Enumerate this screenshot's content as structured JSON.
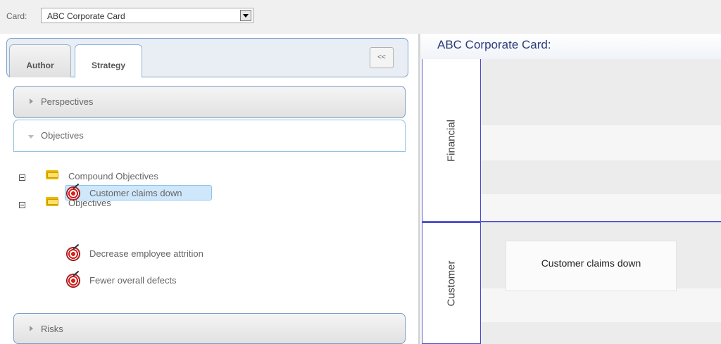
{
  "topbar": {
    "card_label": "Card:",
    "card_value": "ABC Corporate Card"
  },
  "left_panel": {
    "tabs": [
      {
        "label": "Author",
        "active": false
      },
      {
        "label": "Strategy",
        "active": true
      }
    ],
    "collapse_label": "<<",
    "sections": {
      "perspectives": "Perspectives",
      "objectives": "Objectives",
      "risks": "Risks"
    },
    "tree": {
      "compound_folder": "Compound Objectives",
      "objectives_folder": "Objectives",
      "items": [
        {
          "label": "Customer claims down",
          "selected": true
        },
        {
          "label": "Decrease employee attrition",
          "selected": false
        },
        {
          "label": "Fewer overall defects",
          "selected": false
        }
      ]
    }
  },
  "right_panel": {
    "title": "ABC Corporate Card:",
    "lanes": [
      {
        "label": "Financial"
      },
      {
        "label": "Customer"
      }
    ],
    "objective_box": "Customer claims down"
  },
  "colors": {
    "lane_border": "#4a4ad0",
    "selection": "#cfe7fb",
    "title_text": "#2a3a7a"
  },
  "icons": {
    "folder": "folder-icon",
    "objective": "target-icon",
    "expander": "collapse-box-icon"
  }
}
